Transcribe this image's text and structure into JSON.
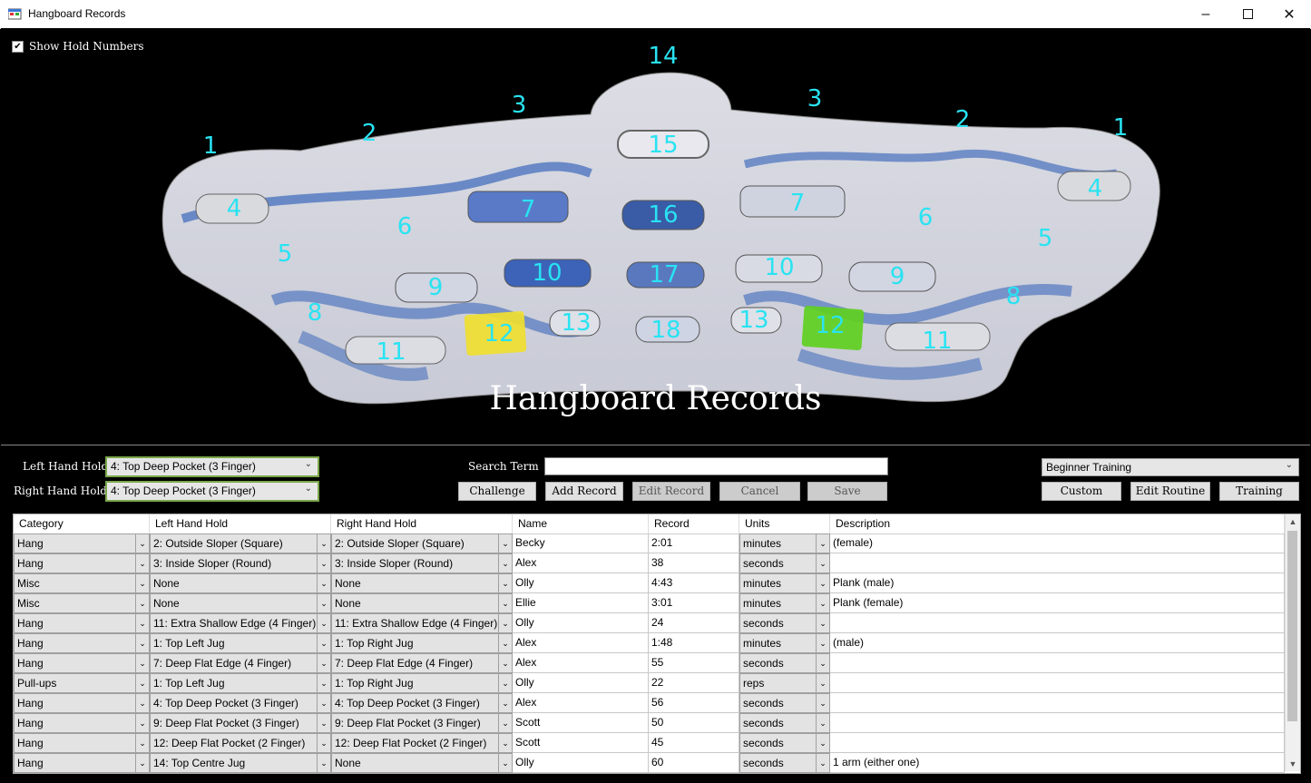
{
  "window": {
    "title": "Hangboard Records"
  },
  "board": {
    "show_hold_numbers_label": "Show Hold Numbers",
    "show_hold_numbers_checked": true,
    "title": "Hangboard Records",
    "hold_numbers": [
      "14",
      "3",
      "3",
      "2",
      "2",
      "1",
      "1",
      "15",
      "4",
      "4",
      "7",
      "7",
      "16",
      "6",
      "6",
      "5",
      "5",
      "10",
      "10",
      "17",
      "9",
      "9",
      "8",
      "8",
      "12",
      "12",
      "13",
      "13",
      "18",
      "11",
      "11"
    ]
  },
  "controls": {
    "left_hold_label": "Left Hand Hold",
    "left_hold_value": "4: Top Deep Pocket (3 Finger)",
    "right_hold_label": "Right Hand Hold",
    "right_hold_value": "4: Top Deep Pocket (3 Finger)",
    "search_label": "Search Term",
    "search_value": "",
    "routine_value": "Beginner Training",
    "buttons": {
      "challenge": "Challenge",
      "add_record": "Add Record",
      "edit_record": "Edit Record",
      "cancel": "Cancel",
      "save": "Save",
      "custom": "Custom",
      "edit_routine": "Edit Routine",
      "training": "Training"
    }
  },
  "table": {
    "columns": [
      "Category",
      "Left Hand Hold",
      "Right Hand Hold",
      "Name",
      "Record",
      "Units",
      "Description"
    ],
    "rows": [
      [
        "Hang",
        "2: Outside Sloper (Square)",
        "2: Outside Sloper (Square)",
        "Becky",
        "2:01",
        "minutes",
        "(female)"
      ],
      [
        "Hang",
        "3: Inside Sloper (Round)",
        "3: Inside Sloper (Round)",
        "Alex",
        "38",
        "seconds",
        ""
      ],
      [
        "Misc",
        "None",
        "None",
        "Olly",
        "4:43",
        "minutes",
        "Plank (male)"
      ],
      [
        "Misc",
        "None",
        "None",
        "Ellie",
        "3:01",
        "minutes",
        "Plank (female)"
      ],
      [
        "Hang",
        "11: Extra Shallow Edge (4 Finger)",
        "11: Extra Shallow Edge (4 Finger)",
        "Olly",
        "24",
        "seconds",
        ""
      ],
      [
        "Hang",
        "1: Top Left Jug",
        "1: Top Right Jug",
        "Alex",
        "1:48",
        "minutes",
        "(male)"
      ],
      [
        "Hang",
        "7: Deep Flat Edge (4 Finger)",
        "7: Deep Flat Edge (4 Finger)",
        "Alex",
        "55",
        "seconds",
        ""
      ],
      [
        "Pull-ups",
        "1: Top Left Jug",
        "1: Top Right Jug",
        "Olly",
        "22",
        "reps",
        ""
      ],
      [
        "Hang",
        "4: Top Deep Pocket (3 Finger)",
        "4: Top Deep Pocket (3 Finger)",
        "Alex",
        "56",
        "seconds",
        ""
      ],
      [
        "Hang",
        "9: Deep Flat Pocket (3 Finger)",
        "9: Deep Flat Pocket (3 Finger)",
        "Scott",
        "50",
        "seconds",
        ""
      ],
      [
        "Hang",
        "12: Deep Flat Pocket (2 Finger)",
        "12: Deep Flat Pocket (2 Finger)",
        "Scott",
        "45",
        "seconds",
        ""
      ],
      [
        "Hang",
        "14: Top Centre Jug",
        "None",
        "Olly",
        "60",
        "seconds",
        "1 arm (either one)"
      ]
    ]
  },
  "colors": {
    "hold_number": "#29e3f2",
    "left_highlight": "#f0e030",
    "right_highlight": "#60d020"
  }
}
